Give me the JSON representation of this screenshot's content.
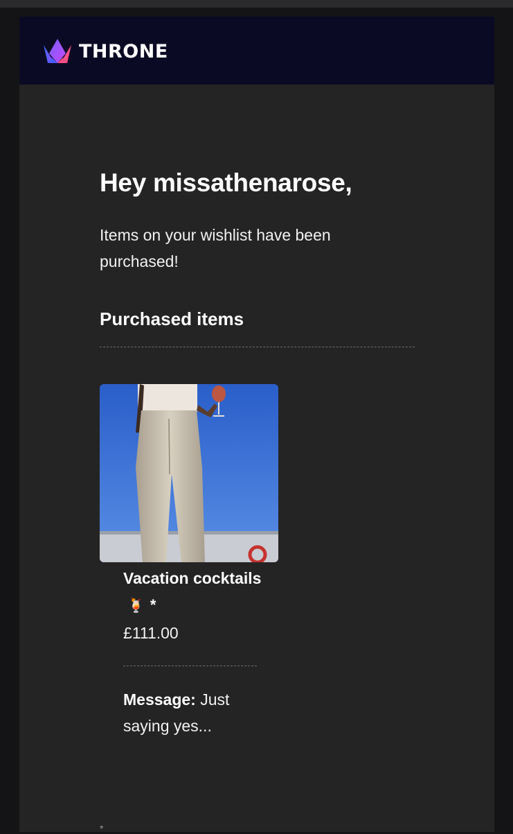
{
  "brand": {
    "name": "THRONE",
    "logo_icon": "crown-icon",
    "header_bg": "#0b0a24"
  },
  "email": {
    "greeting": "Hey missathenarose,",
    "intro": "Items on your wishlist have been purchased!",
    "section_title": "Purchased items",
    "item": {
      "image_icon": "product-photo",
      "name": "Vacation cocktails",
      "emoji": "🍹",
      "marker": "*",
      "price": "£111.00",
      "message_label": "Message:",
      "message": "Just saying yes..."
    },
    "footer_mark": "*"
  },
  "colors": {
    "body_bg": "#252424",
    "page_bg": "#141416",
    "text": "#ffffff"
  }
}
